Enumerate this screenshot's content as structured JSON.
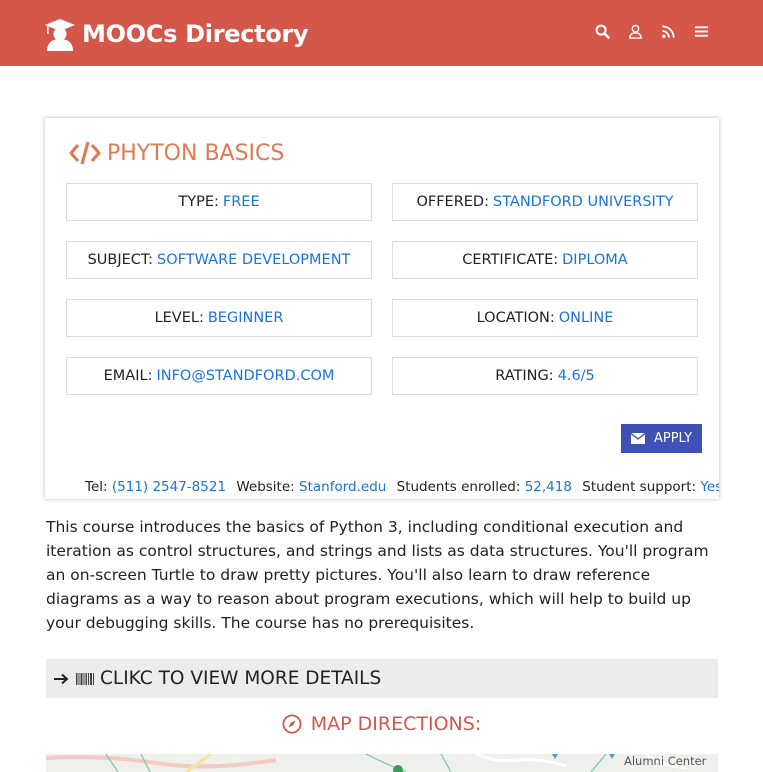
{
  "header": {
    "brand": "MOOCs Directory",
    "icons": [
      "search-icon",
      "user-icon",
      "rss-icon",
      "menu-icon"
    ],
    "background_color": "#d5574a"
  },
  "course": {
    "title": "PHYTON BASICS",
    "fields": [
      {
        "label": "TYPE:",
        "value": "FREE"
      },
      {
        "label": "OFFERED:",
        "value": "STANDFORD UNIVERSITY"
      },
      {
        "label": "SUBJECT:",
        "value": "SOFTWARE DEVELOPMENT"
      },
      {
        "label": "CERTIFICATE:",
        "value": "DIPLOMA"
      },
      {
        "label": "LEVEL:",
        "value": "BEGINNER"
      },
      {
        "label": "LOCATION:",
        "value": "ONLINE"
      },
      {
        "label": "EMAIL:",
        "value": "INFO@STANDFORD.COM"
      },
      {
        "label": "RATING:",
        "value": "4.6/5"
      }
    ],
    "apply_label": "APPLY",
    "contact": {
      "tel_label": "Tel:",
      "tel": "(511) 2547-8521",
      "website_label": "Website:",
      "website": "Stanford.edu",
      "students_label": "Students enrolled:",
      "students": "52,418",
      "support_label": "Student support:",
      "support": "Yes"
    }
  },
  "description": "This course introduces the basics of Python 3, including conditional execution and iteration as control structures, and strings and lists as data structures. You'll program an on-screen Turtle to draw pretty pictures. You'll also learn to draw reference diagrams as a way to reason about program executions, which will help to build up your debugging skills. The course has no prerequisites.",
  "details_label": "CLIKC TO VIEW MORE DETAILS",
  "map": {
    "heading": "MAP DIRECTIONS:",
    "visible_label": "Alumni Center"
  },
  "colors": {
    "accent": "#d5574a",
    "title": "#e07a52",
    "link": "#1a73d9",
    "button": "#3f51b5"
  }
}
